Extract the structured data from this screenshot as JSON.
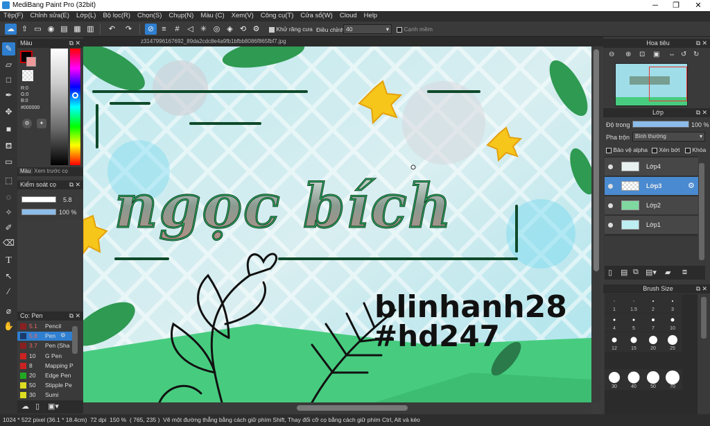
{
  "window": {
    "title": "MediBang Paint Pro (32bit)"
  },
  "menu": [
    "Tệp(F)",
    "Chỉnh sửa(E)",
    "Lớp(L)",
    "Bộ lọc(R)",
    "Chọn(S)",
    "Chụp(N)",
    "Màu (C)",
    "Xem(V)",
    "Công cụ(T)",
    "Cửa sổ(W)",
    "Cloud",
    "Help"
  ],
  "toolbar": {
    "antialias_label": "Khử răng cưa",
    "correction_label": "Điều chỉnh",
    "correction_value": "40",
    "soft_edge_label": "Cạnh mềm"
  },
  "color_panel": {
    "title": "Màu",
    "r": "R:0",
    "g": "G:0",
    "b": "B:0",
    "hex": "#000000",
    "tab_color": "Màu",
    "tab_preview": "Xem trước cọ"
  },
  "brush_control": {
    "title": "Kiểm soát cọ",
    "size": "5.8",
    "opacity": "100 %"
  },
  "brush_list": {
    "title": "Cọ: Pen",
    "items": [
      {
        "size": "5.1",
        "name": "Pencil",
        "color": "#8b2020"
      },
      {
        "size": "5.8",
        "name": "Pen",
        "color": "#1a3a6a"
      },
      {
        "size": "3.7",
        "name": "Pen (Sha",
        "color": "#8b2020"
      },
      {
        "size": "10",
        "name": "G Pen",
        "color": "#cc2222"
      },
      {
        "size": "8",
        "name": "Mapping P",
        "color": "#cc2222"
      },
      {
        "size": "20",
        "name": "Edge Pen",
        "color": "#22aa22"
      },
      {
        "size": "50",
        "name": "Stipple Pe",
        "color": "#dddd22"
      },
      {
        "size": "30",
        "name": "Sumi",
        "color": "#dddd22"
      }
    ]
  },
  "canvas": {
    "tab_filename": "z3147996167692_89da2cdc8e4a9fb1bfbb8086f865fbf7.jpg",
    "main_text": "ngọc bích",
    "sub_text_1": "blinhanh28",
    "sub_text_2": "#hd247"
  },
  "navigator": {
    "title": "Hoa tiêu"
  },
  "layer_panel": {
    "title": "Lớp",
    "opacity_label": "Độ trong",
    "opacity_value": "100 %",
    "opacity_fraction": 1.0,
    "blend_label": "Pha trộn",
    "blend_value": "Bình thường",
    "protect_alpha": "Bảo vệ alpha",
    "clipping": "Xén bớt",
    "lock": "Khóa",
    "layers": [
      "Lớp4",
      "Lớp3",
      "Lớp2",
      "Lớp1"
    ]
  },
  "brush_size_panel": {
    "title": "Brush Size",
    "sizes": [
      "1",
      "1.5",
      "2",
      "3",
      "4",
      "5",
      "7",
      "10",
      "12",
      "15",
      "20",
      "25",
      "30",
      "40",
      "50",
      "70"
    ]
  },
  "status": {
    "dimensions": "1024 * 522 pixel",
    "cm": "(36.1 * 18.4cm)",
    "dpi": "72 dpi",
    "zoom": "150 %",
    "coords": "( 765, 235 )",
    "hint": "Vẽ một đường thẳng bằng cách giữ phím Shift, Thay đổi cỡ cọ bằng cách giữ phím Ctrl, Alt và kéo"
  },
  "colors": {
    "accent": "#2f7fd0",
    "text_fill": "#2d8a5a"
  }
}
